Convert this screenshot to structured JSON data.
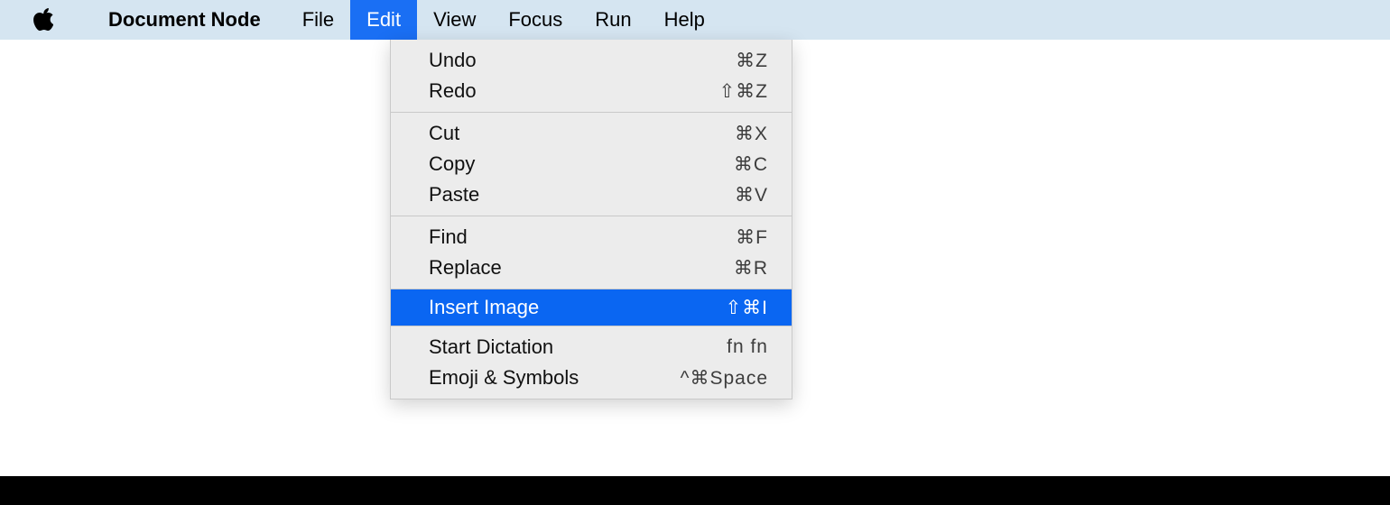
{
  "menubar": {
    "app_name": "Document Node",
    "items": [
      {
        "label": "File",
        "active": false
      },
      {
        "label": "Edit",
        "active": true
      },
      {
        "label": "View",
        "active": false
      },
      {
        "label": "Focus",
        "active": false
      },
      {
        "label": "Run",
        "active": false
      },
      {
        "label": "Help",
        "active": false
      }
    ]
  },
  "dropdown": {
    "groups": [
      [
        {
          "label": "Undo",
          "shortcut": "⌘Z",
          "highlight": false
        },
        {
          "label": "Redo",
          "shortcut": "⇧⌘Z",
          "highlight": false
        }
      ],
      [
        {
          "label": "Cut",
          "shortcut": "⌘X",
          "highlight": false
        },
        {
          "label": "Copy",
          "shortcut": "⌘C",
          "highlight": false
        },
        {
          "label": "Paste",
          "shortcut": "⌘V",
          "highlight": false
        }
      ],
      [
        {
          "label": "Find",
          "shortcut": "⌘F",
          "highlight": false
        },
        {
          "label": "Replace",
          "shortcut": "⌘R",
          "highlight": false
        }
      ],
      [
        {
          "label": "Insert Image",
          "shortcut": "⇧⌘I",
          "highlight": true
        }
      ],
      [
        {
          "label": "Start Dictation",
          "shortcut": "fn fn",
          "highlight": false
        },
        {
          "label": "Emoji & Symbols",
          "shortcut": "^⌘Space",
          "highlight": false
        }
      ]
    ]
  }
}
